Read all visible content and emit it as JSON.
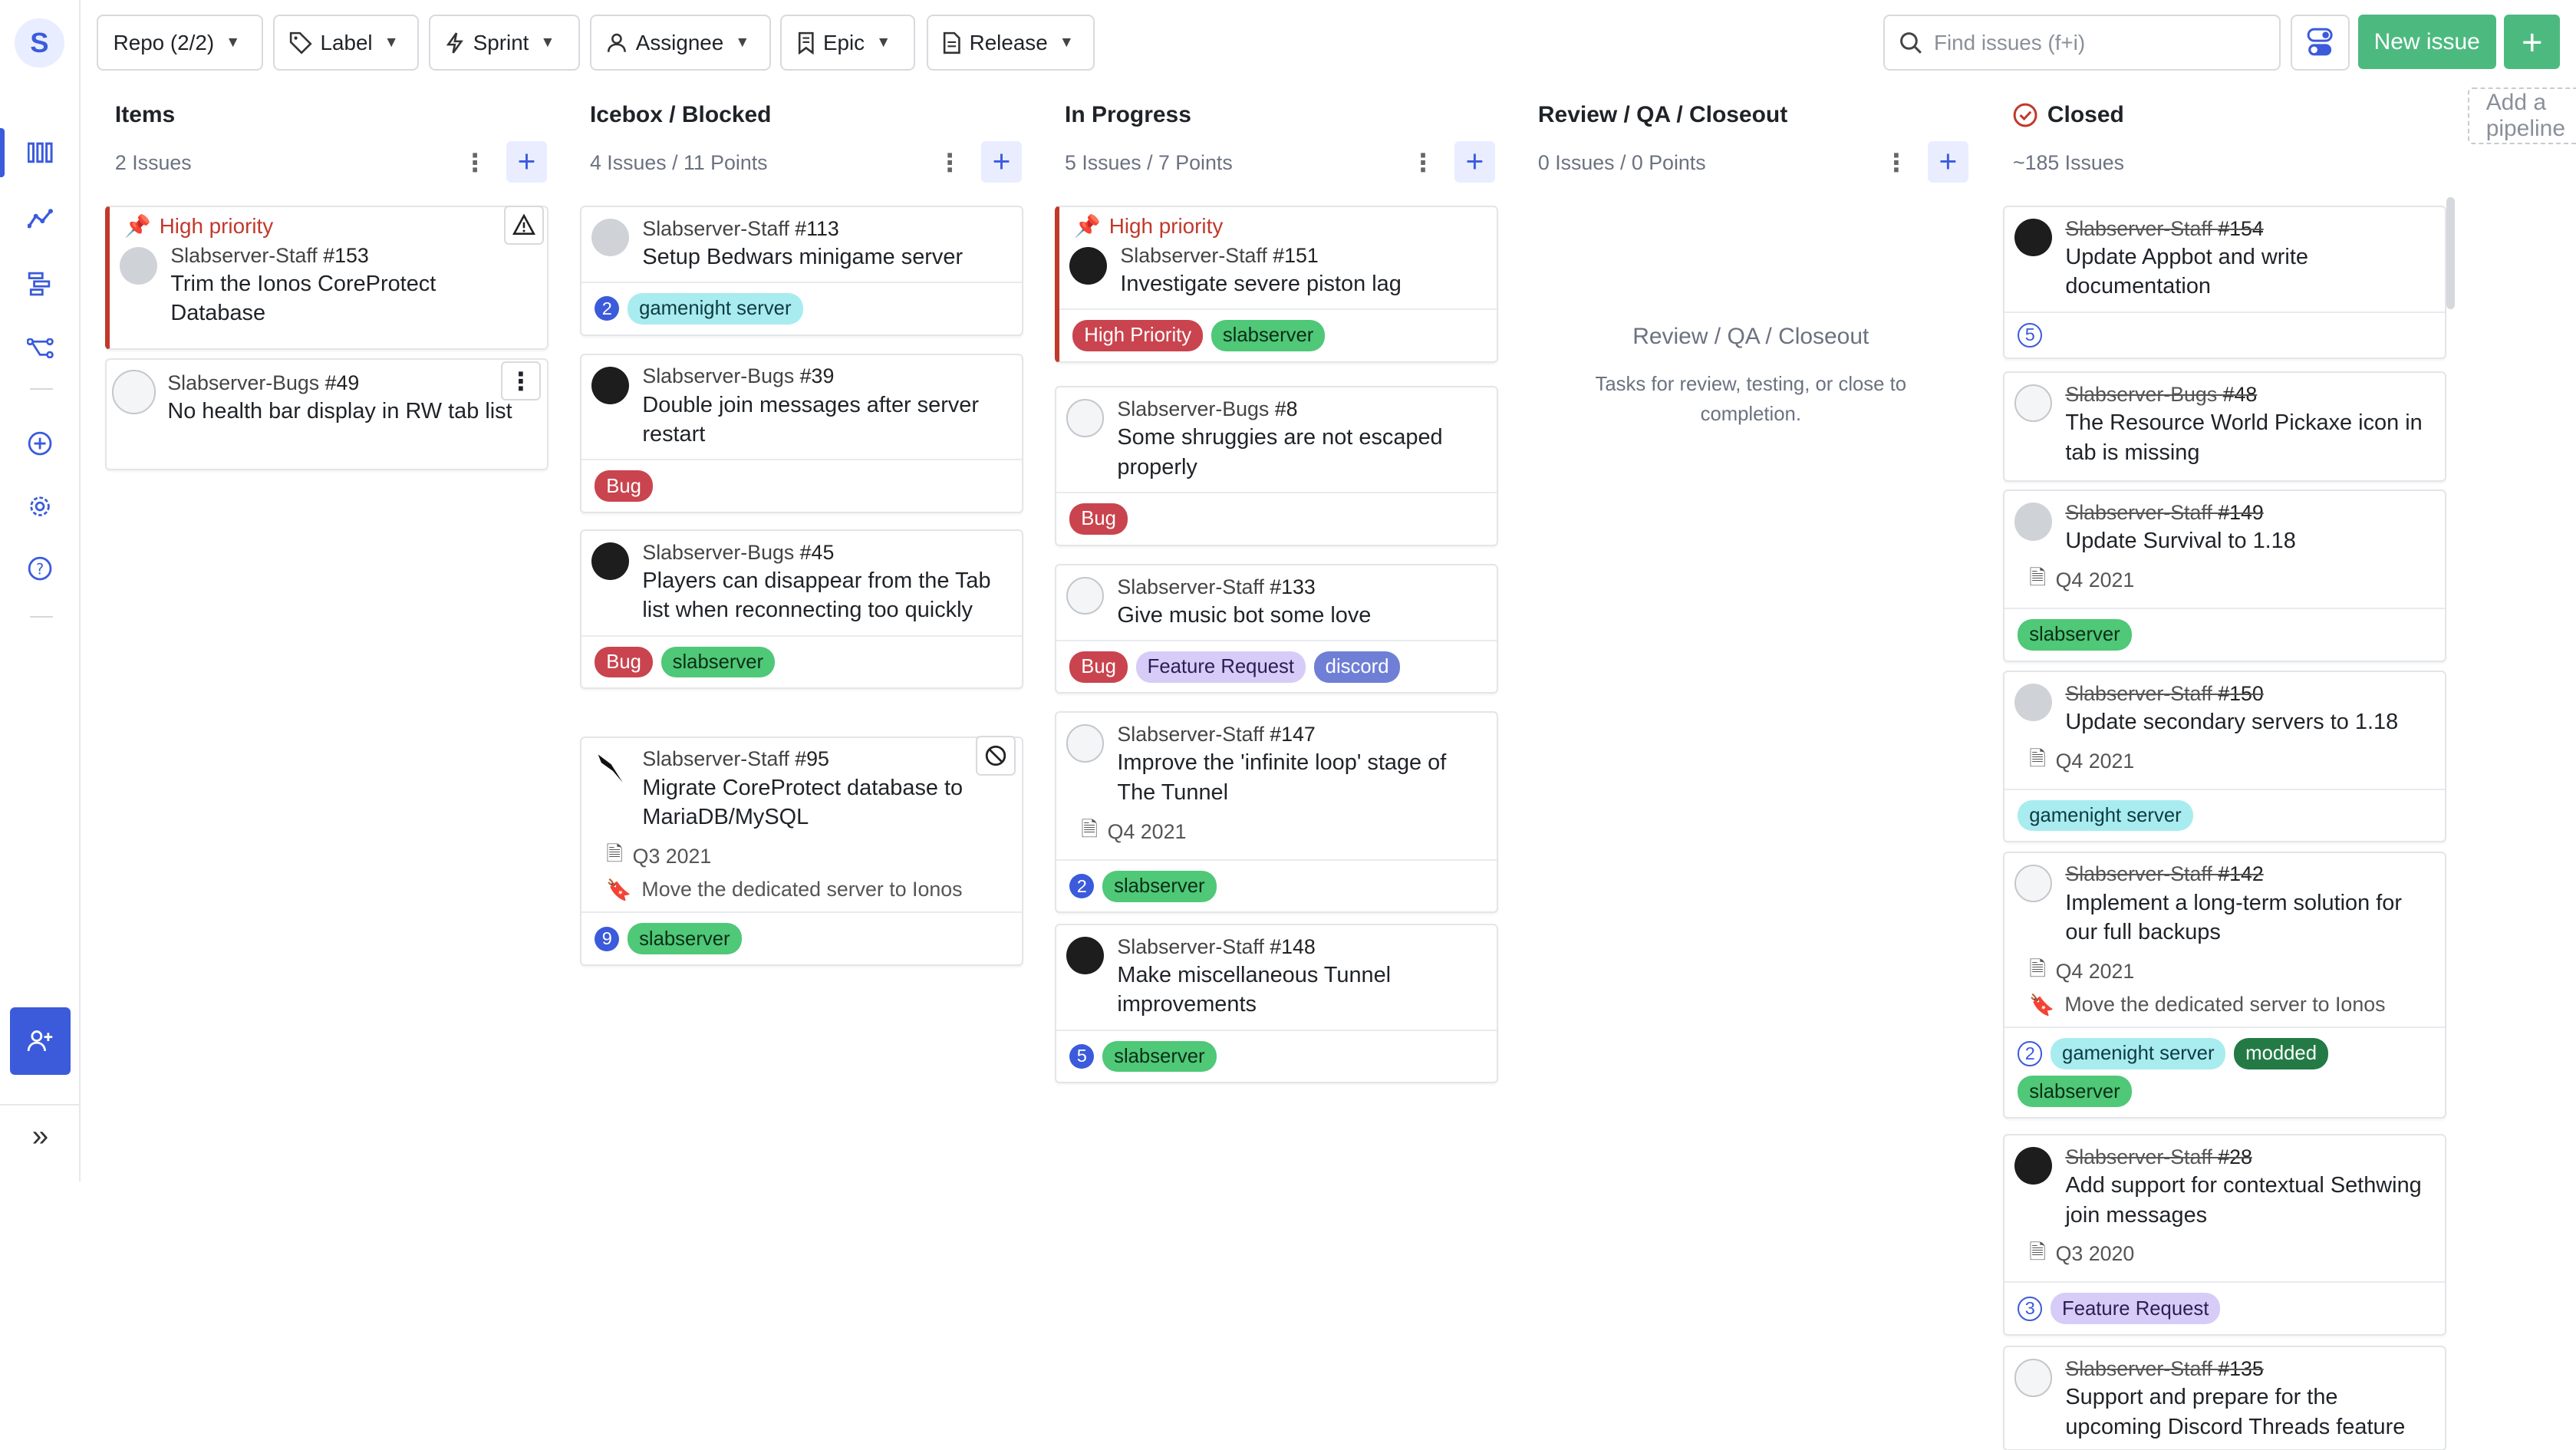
{
  "sidebar": {
    "logo_letter": "S",
    "items": [
      {
        "icon": "board-icon"
      },
      {
        "icon": "reports-icon"
      },
      {
        "icon": "roadmap-icon"
      },
      {
        "icon": "dependencies-icon"
      },
      {
        "icon": "add-workspace-icon"
      },
      {
        "icon": "settings-gear-icon"
      },
      {
        "icon": "help-icon"
      }
    ],
    "invite_icon": "invite-user-icon",
    "expand_glyph": "»"
  },
  "toolbar": {
    "filters": [
      {
        "label": "Repo (2/2)"
      },
      {
        "label": "Label"
      },
      {
        "label": "Sprint"
      },
      {
        "label": "Assignee"
      },
      {
        "label": "Epic"
      },
      {
        "label": "Release"
      }
    ],
    "search_placeholder": "Find issues (f+i)",
    "new_issue_label": "New issue",
    "plus_label": "+"
  },
  "colors": {
    "accent": "#3b5bdb",
    "green": "#4cba7f",
    "priority_red": "#c0392b"
  },
  "common": {
    "high_priority": "High priority"
  },
  "columns": [
    {
      "title": "Items",
      "count": "2 Issues",
      "cards": [
        {
          "ref_repo": "Slabserver-Staff ",
          "ref_num": "#153",
          "title": "Trim the Ionos CoreProtect Database"
        },
        {
          "ref_repo": "Slabserver-Bugs ",
          "ref_num": "#49",
          "title": "No health bar display in RW tab list"
        }
      ]
    },
    {
      "title": "Icebox / Blocked",
      "count": "4 Issues / 11 Points",
      "cards": [
        {
          "ref_repo": "Slabserver-Staff ",
          "ref_num": "#113",
          "title": "Setup Bedwars minigame server",
          "estimate": "2",
          "labels": [
            "gamenight server"
          ]
        },
        {
          "ref_repo": "Slabserver-Bugs ",
          "ref_num": "#39",
          "title": "Double join messages after server restart",
          "labels": [
            "Bug"
          ]
        },
        {
          "ref_repo": "Slabserver-Bugs ",
          "ref_num": "#45",
          "title": "Players can disappear from the Tab list when reconnecting too quickly",
          "labels": [
            "Bug",
            "slabserver"
          ]
        },
        {
          "ref_repo": "Slabserver-Staff ",
          "ref_num": "#95",
          "title": "Migrate CoreProtect database to MariaDB/MySQL",
          "release": "Q3 2021",
          "epic": "Move the dedicated server to Ionos",
          "estimate": "9",
          "labels": [
            "slabserver"
          ]
        }
      ]
    },
    {
      "title": "In Progress",
      "count": "5 Issues / 7 Points",
      "cards": [
        {
          "ref_repo": "Slabserver-Staff ",
          "ref_num": "#151",
          "title": "Investigate severe piston lag",
          "labels": [
            "High Priority",
            "slabserver"
          ]
        },
        {
          "ref_repo": "Slabserver-Bugs ",
          "ref_num": "#8",
          "title": "Some shruggies are not escaped properly",
          "labels": [
            "Bug"
          ]
        },
        {
          "ref_repo": "Slabserver-Staff ",
          "ref_num": "#133",
          "title": "Give music bot some love",
          "labels": [
            "Bug",
            "Feature Request",
            "discord"
          ]
        },
        {
          "ref_repo": "Slabserver-Staff ",
          "ref_num": "#147",
          "title": "Improve the 'infinite loop' stage of The Tunnel",
          "release": "Q4 2021",
          "estimate": "2",
          "labels": [
            "slabserver"
          ]
        },
        {
          "ref_repo": "Slabserver-Staff ",
          "ref_num": "#148",
          "title": "Make miscellaneous Tunnel improvements",
          "estimate": "5",
          "labels": [
            "slabserver"
          ]
        }
      ]
    },
    {
      "title": "Review / QA / Closeout",
      "count": "0 Issues / 0 Points",
      "empty_title": "Review / QA / Closeout",
      "empty_desc": "Tasks for review, testing, or close to completion."
    },
    {
      "title": "Closed",
      "count": "~185 Issues",
      "cards": [
        {
          "ref_repo": "Slabserver-Staff ",
          "ref_num": "#154",
          "title": "Update Appbot and write documentation",
          "estimate": "5"
        },
        {
          "ref_repo": "Slabserver-Bugs ",
          "ref_num": "#48",
          "title": "The Resource World Pickaxe icon in tab is missing"
        },
        {
          "ref_repo": "Slabserver-Staff ",
          "ref_num": "#149",
          "title": "Update Survival to 1.18",
          "release": "Q4 2021",
          "labels": [
            "slabserver"
          ]
        },
        {
          "ref_repo": "Slabserver-Staff ",
          "ref_num": "#150",
          "title": "Update secondary servers to 1.18",
          "release": "Q4 2021",
          "labels": [
            "gamenight server"
          ]
        },
        {
          "ref_repo": "Slabserver-Staff ",
          "ref_num": "#142",
          "title": "Implement a long-term solution for our full backups",
          "release": "Q4 2021",
          "epic": "Move the dedicated server to Ionos",
          "estimate": "2",
          "labels": [
            "gamenight server",
            "modded",
            "slabserver"
          ]
        },
        {
          "ref_repo": "Slabserver-Staff ",
          "ref_num": "#28",
          "title": "Add support for contextual Sethwing join messages",
          "release": "Q3 2020",
          "estimate": "3",
          "labels": [
            "Feature Request"
          ]
        },
        {
          "ref_repo": "Slabserver-Staff ",
          "ref_num": "#135",
          "title": "Support and prepare for the upcoming Discord Threads feature"
        }
      ]
    }
  ],
  "add_pipeline": "Add a pipeline",
  "label_colors": {
    "gamenight server": {
      "bg": "#a8ecf0",
      "fg": "#0f3b40"
    },
    "Bug": {
      "bg": "#c9444e",
      "fg": "#ffffff"
    },
    "slabserver": {
      "bg": "#4fc877",
      "fg": "#0b2e17"
    },
    "High Priority": {
      "bg": "#c9444e",
      "fg": "#ffffff"
    },
    "Feature Request": {
      "bg": "#d7ccf7",
      "fg": "#2a1f52"
    },
    "discord": {
      "bg": "#6f7fd6",
      "fg": "#ffffff"
    },
    "modded": {
      "bg": "#237a45",
      "fg": "#ffffff"
    }
  }
}
